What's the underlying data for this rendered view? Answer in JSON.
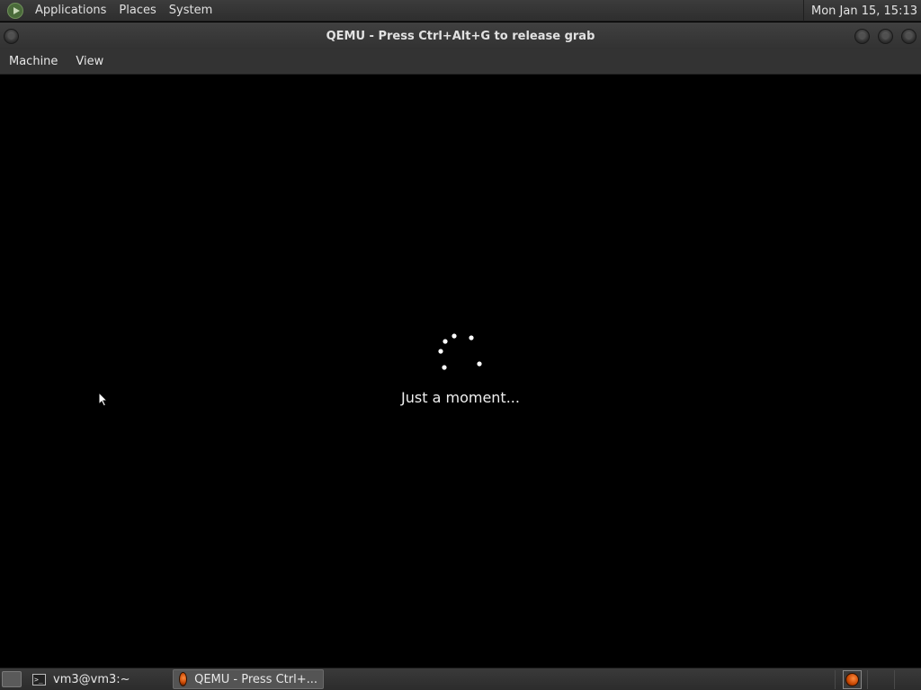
{
  "top_panel": {
    "menus": [
      "Applications",
      "Places",
      "System"
    ],
    "clock": "Mon Jan 15, 15:13"
  },
  "window": {
    "title": "QEMU - Press Ctrl+Alt+G to release grab",
    "menu": [
      "Machine",
      "View"
    ]
  },
  "vm_screen": {
    "loading_text": "Just a moment..."
  },
  "taskbar": {
    "tasks": [
      {
        "label": "vm3@vm3:~",
        "icon": "terminal-icon"
      },
      {
        "label": "QEMU - Press Ctrl+...",
        "icon": "qemu-icon",
        "active": true
      }
    ]
  },
  "colors": {
    "panel": "#333333",
    "screen": "#000000",
    "spinner_dot": "#ffffff"
  }
}
